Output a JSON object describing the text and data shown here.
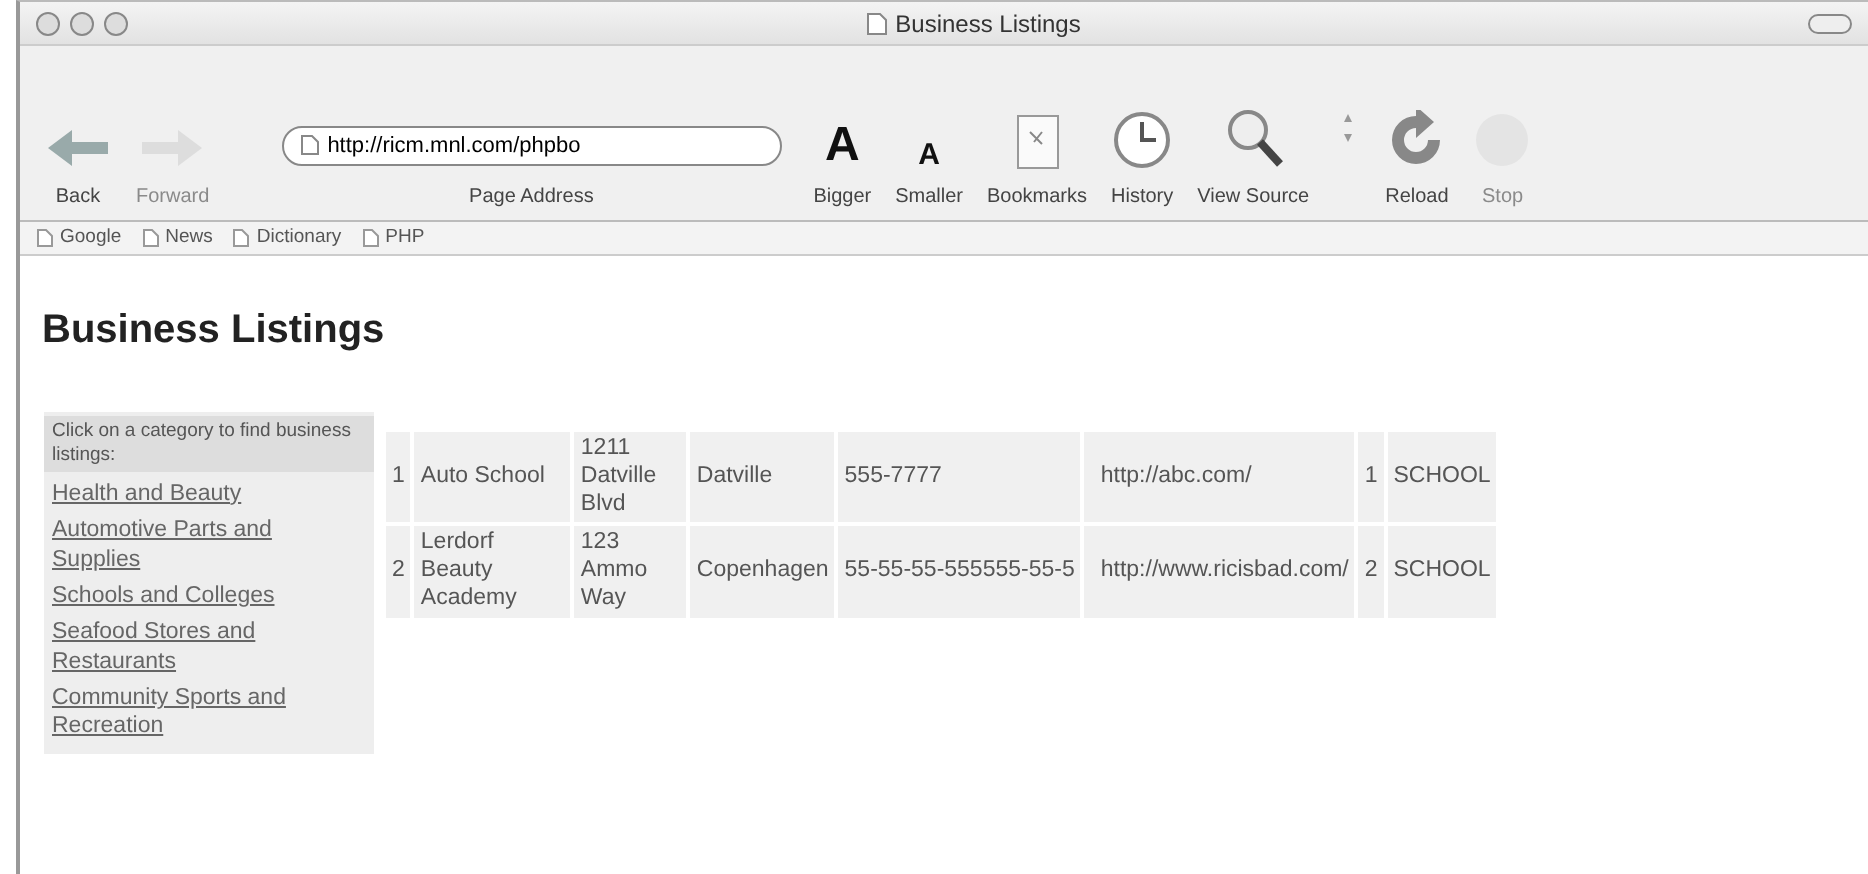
{
  "window": {
    "title": "Business Listings"
  },
  "toolbar": {
    "buttons": [
      {
        "kind": "back",
        "label": "Back",
        "disabled": false
      },
      {
        "kind": "forward",
        "label": "Forward",
        "disabled": true
      },
      {
        "kind": "address",
        "label": "Page Address",
        "value": "http://ricm.mnl.com/phpbo"
      },
      {
        "kind": "bigger",
        "label": "Bigger",
        "glyph": "A",
        "disabled": false
      },
      {
        "kind": "smaller",
        "label": "Smaller",
        "glyph": "A",
        "disabled": false
      },
      {
        "kind": "bookmarks",
        "label": "Bookmarks",
        "disabled": false
      },
      {
        "kind": "history",
        "label": "History",
        "disabled": false
      },
      {
        "kind": "source",
        "label": "View Source",
        "disabled": false
      },
      {
        "kind": "stepper"
      },
      {
        "kind": "reload",
        "label": "Reload",
        "disabled": false
      },
      {
        "kind": "stop",
        "label": "Stop",
        "disabled": true
      }
    ]
  },
  "bookmarks_bar": [
    "Google",
    "News",
    "Dictionary",
    "PHP"
  ],
  "page": {
    "heading": "Business Listings",
    "sidebar": {
      "prompt": "Click on a category to find business listings:",
      "links": [
        "Health and Beauty",
        "Automotive Parts and Supplies",
        "Schools and Colleges",
        "Seafood Stores and Restaurants",
        "Community Sports and Recreation"
      ]
    },
    "table": {
      "rows": [
        [
          "1",
          "Auto School",
          "1211 Datville Blvd",
          "Datville",
          "555-7777",
          "http://abc.com/",
          "1",
          "SCHOOL"
        ],
        [
          "2",
          "Lerdorf Beauty Academy",
          "123 Ammo Way",
          "Copenhagen",
          "55-55-55-555555-55-5",
          "http://www.ricisbad.com/",
          "2",
          "SCHOOL"
        ]
      ]
    }
  }
}
